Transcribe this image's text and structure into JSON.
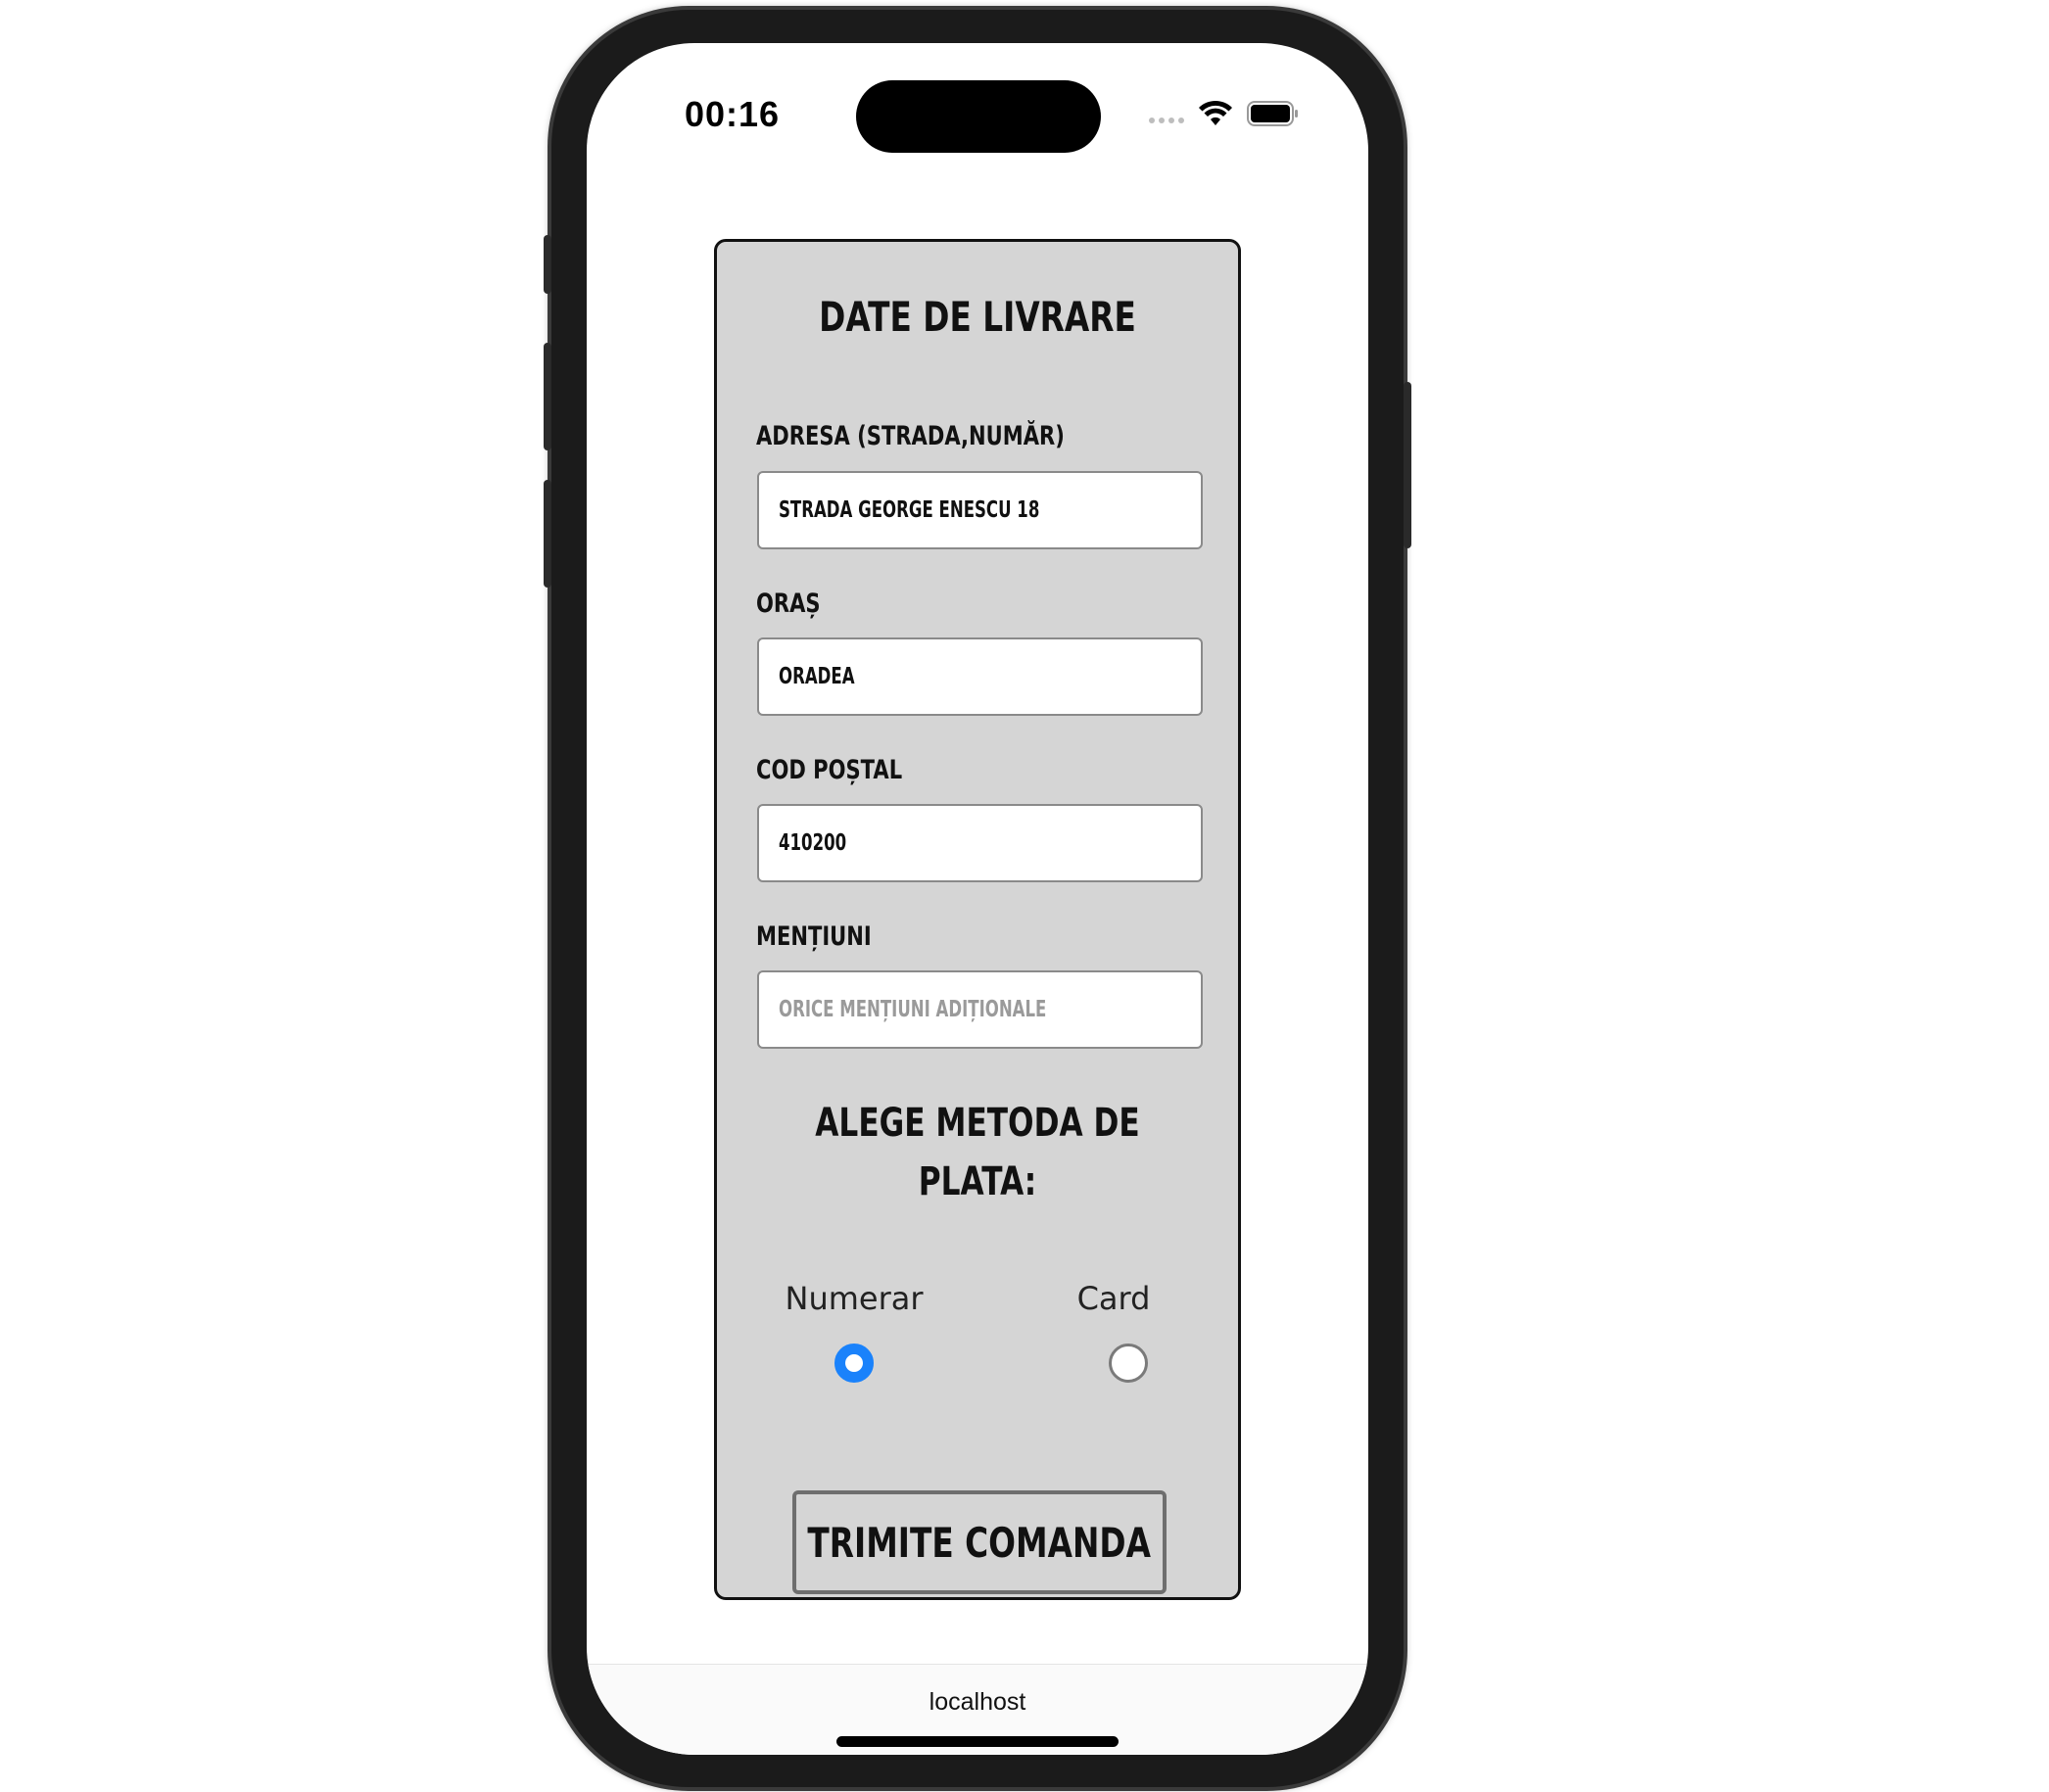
{
  "status_bar": {
    "time": "00:16",
    "wifi_icon": "wifi-icon",
    "battery_icon": "battery-icon"
  },
  "form": {
    "title": "DATE DE LIVRARE",
    "address_label": "ADRESA (STRADA,NUMĂR)",
    "address_value": "STRADA GEORGE ENESCU 18",
    "city_label": "ORAȘ",
    "city_value": "ORADEA",
    "postal_label": "COD POȘTAL",
    "postal_value": "410200",
    "notes_label": "MENȚIUNI",
    "notes_placeholder": "ORICE MENȚIUNI ADIȚIONALE",
    "payment_title_line1": "ALEGE METODA DE",
    "payment_title_line2": "PLATA:",
    "payment_options": [
      {
        "label": "Numerar",
        "selected": true
      },
      {
        "label": "Card",
        "selected": false
      }
    ],
    "submit_label": "TRIMITE COMANDA"
  },
  "browser": {
    "url": "localhost"
  },
  "colors": {
    "card_background": "#d5d5d5",
    "radio_selected": "#1a82fb"
  }
}
